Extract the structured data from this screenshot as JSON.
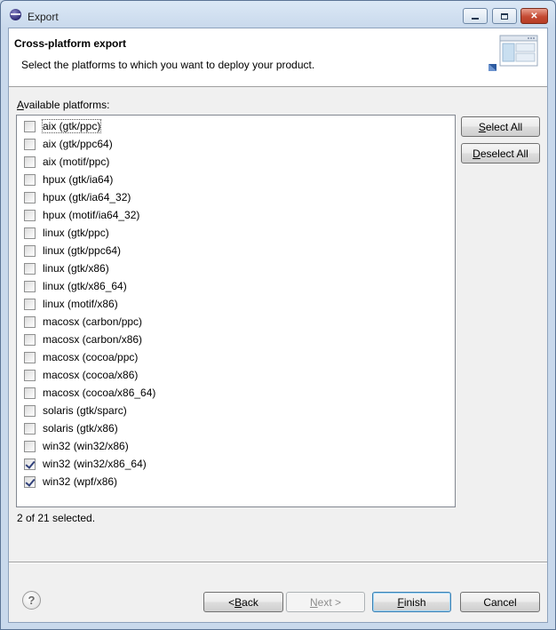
{
  "window": {
    "title": "Export",
    "min_glyph": "",
    "max_glyph": "",
    "close_glyph": "✕"
  },
  "header": {
    "title": "Cross-platform export",
    "description": "Select the platforms to which you want to deploy your product."
  },
  "list": {
    "label_mnemonic": "A",
    "label_rest": "vailable platforms:",
    "items": [
      {
        "label": "aix (gtk/ppc)",
        "checked": false
      },
      {
        "label": "aix (gtk/ppc64)",
        "checked": false
      },
      {
        "label": "aix (motif/ppc)",
        "checked": false
      },
      {
        "label": "hpux (gtk/ia64)",
        "checked": false
      },
      {
        "label": "hpux (gtk/ia64_32)",
        "checked": false
      },
      {
        "label": "hpux (motif/ia64_32)",
        "checked": false
      },
      {
        "label": "linux (gtk/ppc)",
        "checked": false
      },
      {
        "label": "linux (gtk/ppc64)",
        "checked": false
      },
      {
        "label": "linux (gtk/x86)",
        "checked": false
      },
      {
        "label": "linux (gtk/x86_64)",
        "checked": false
      },
      {
        "label": "linux (motif/x86)",
        "checked": false
      },
      {
        "label": "macosx (carbon/ppc)",
        "checked": false
      },
      {
        "label": "macosx (carbon/x86)",
        "checked": false
      },
      {
        "label": "macosx (cocoa/ppc)",
        "checked": false
      },
      {
        "label": "macosx (cocoa/x86)",
        "checked": false
      },
      {
        "label": "macosx (cocoa/x86_64)",
        "checked": false
      },
      {
        "label": "solaris (gtk/sparc)",
        "checked": false
      },
      {
        "label": "solaris (gtk/x86)",
        "checked": false
      },
      {
        "label": "win32 (win32/x86)",
        "checked": false
      },
      {
        "label": "win32 (win32/x86_64)",
        "checked": true
      },
      {
        "label": "win32 (wpf/x86)",
        "checked": true
      }
    ]
  },
  "buttons": {
    "select_all": {
      "mnemonic": "S",
      "rest": "elect All"
    },
    "deselect_all": {
      "mnemonic": "D",
      "rest": "eselect All"
    },
    "back": {
      "prefix": "< ",
      "mnemonic": "B",
      "rest": "ack"
    },
    "next": {
      "mnemonic": "N",
      "rest": "ext >"
    },
    "finish": {
      "mnemonic": "F",
      "rest": "inish"
    },
    "cancel": "Cancel"
  },
  "status": "2 of 21 selected.",
  "help_glyph": "?"
}
